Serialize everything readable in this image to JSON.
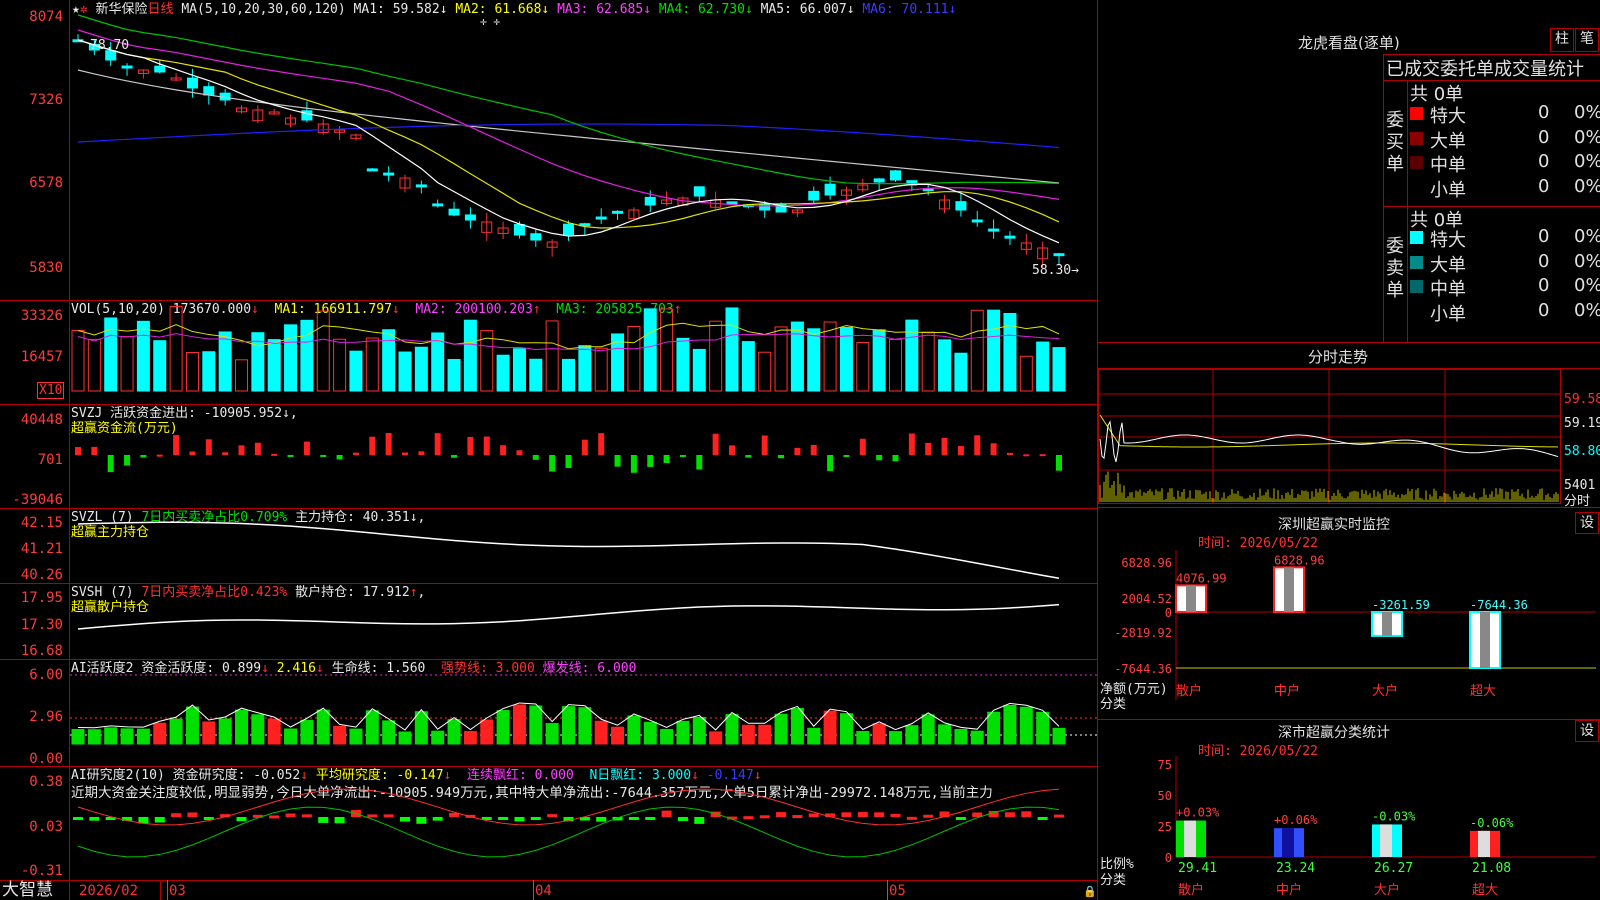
{
  "stock": {
    "name": "新华保险",
    "period": "日线",
    "ma_label": "MA(5,10,20,30,60,120)",
    "ma": [
      {
        "k": "MA1:",
        "v": "59.582"
      },
      {
        "k": "MA2:",
        "v": "61.668"
      },
      {
        "k": "MA3:",
        "v": "62.685"
      },
      {
        "k": "MA4:",
        "v": "62.730"
      },
      {
        "k": "MA5:",
        "v": "66.007"
      },
      {
        "k": "MA6:",
        "v": "70.111"
      }
    ],
    "arrow": "↓",
    "high_label": "78.70",
    "low_label": "58.30",
    "top_marker": "✛ ✛"
  },
  "price_axis": [
    "8074",
    "7326",
    "6578",
    "5830"
  ],
  "vol": {
    "label": "VOL(5,10,20)",
    "val": "173670.000",
    "ma1": "MA1: 166911.797",
    "ma2": "MA2: 200100.203",
    "ma3": "MA3: 205825.703",
    "axis": [
      "33326",
      "16457"
    ],
    "unit": "X10"
  },
  "svzj": {
    "label": "SVZJ",
    "title": "活跃资金进出: -10905.952",
    "sub": "超赢资金流(万元)",
    "axis": [
      "40448",
      "701",
      "-39046"
    ]
  },
  "svzl": {
    "label": "SVZL (7)",
    "pct": "7日内买卖净占比0.709%",
    "hold": "主力持仓: 40.351",
    "sub": "超赢主力持仓",
    "axis": [
      "42.15",
      "41.21",
      "40.26"
    ]
  },
  "svsh": {
    "label": "SVSH (7)",
    "pct": "7日内买卖净占比0.423%",
    "hold": "散户持仓: 17.912",
    "sub": "超赢散户持仓",
    "axis": [
      "17.95",
      "17.30",
      "16.68"
    ]
  },
  "ai1": {
    "label": "AI活跃度2",
    "a": "资金活跃度: 0.899",
    "b": "2.416",
    "c": "生命线: 1.560",
    "d": "强势线: 3.000",
    "e": "爆发线: 6.000",
    "axis": [
      "6.00",
      "2.96",
      "0.00"
    ]
  },
  "ai2": {
    "label": "AI研究度2(10)",
    "a": "资金研究度: -0.052",
    "b": "平均研究度: -0.147",
    "c": "连续飘红: 0.000",
    "d": "N日飘红: 3.000",
    "e": "-0.147",
    "text": "近期大资金关注度较低,明显弱势,今日大单净流出:-10905.949万元,其中特大单净流出:-7644.357万元,大单5日累计净出-29972.148万元,当前主力",
    "axis": [
      "0.38",
      "0.03",
      "-0.31"
    ]
  },
  "dates": [
    "2026/02",
    "03",
    "04",
    "05"
  ],
  "brand": "大智慧",
  "dragon": {
    "title": "龙虎看盘(逐单)",
    "btn1": "柱",
    "btn2": "笔",
    "header": "已成交委托单成交量统计",
    "buy": {
      "side": "委买单",
      "total": "共 0单",
      "rows": [
        {
          "n": "特大",
          "v": "0",
          "p": "0%",
          "c": "#ff0000"
        },
        {
          "n": "大单",
          "v": "0",
          "p": "0%",
          "c": "#8a0000"
        },
        {
          "n": "中单",
          "v": "0",
          "p": "0%",
          "c": "#5a0000"
        },
        {
          "n": "小单",
          "v": "0",
          "p": "0%",
          "c": ""
        }
      ]
    },
    "sell": {
      "side": "委卖单",
      "total": "共 0单",
      "rows": [
        {
          "n": "特大",
          "v": "0",
          "p": "0%",
          "c": "#00ffff"
        },
        {
          "n": "大单",
          "v": "0",
          "p": "0%",
          "c": "#008a8a"
        },
        {
          "n": "中单",
          "v": "0",
          "p": "0%",
          "c": "#006868"
        },
        {
          "n": "小单",
          "v": "0",
          "p": "0%",
          "c": ""
        }
      ]
    }
  },
  "fenshi": {
    "title": "分时走势",
    "axis": [
      "59.58",
      "59.19",
      "58.80",
      "5401"
    ],
    "unit": "分时"
  },
  "monitor": {
    "title": "深圳超赢实时监控",
    "btn": "设",
    "time": "时间: 2026/05/22",
    "axis": [
      "6828.96",
      "2004.52",
      "0",
      "-2819.92",
      "-7644.36"
    ],
    "ylab": "净额(万元)",
    "xlab": "分类",
    "cats": [
      "散户",
      "中户",
      "大户",
      "超大"
    ],
    "vals": [
      "4076.99",
      "6828.96",
      "-3261.59",
      "-7644.36"
    ]
  },
  "classify": {
    "title": "深市超赢分类统计",
    "btn": "设",
    "time": "时间: 2026/05/22",
    "axis": [
      "75",
      "50",
      "25",
      "0"
    ],
    "ylab": "比例%",
    "xlab": "分类",
    "cats": [
      "散户",
      "中户",
      "大户",
      "超大"
    ],
    "vals": [
      "29.41",
      "23.24",
      "26.27",
      "21.08"
    ],
    "chg": [
      "+0.03%",
      "+0.06%",
      "-0.03%",
      "-0.06%"
    ]
  },
  "chart_data": {
    "type": "candlestick",
    "title": "新华保险 日线",
    "y_range": [
      58.3,
      80.74
    ],
    "notes": "Daily K-line with MA lines; values approximate"
  }
}
